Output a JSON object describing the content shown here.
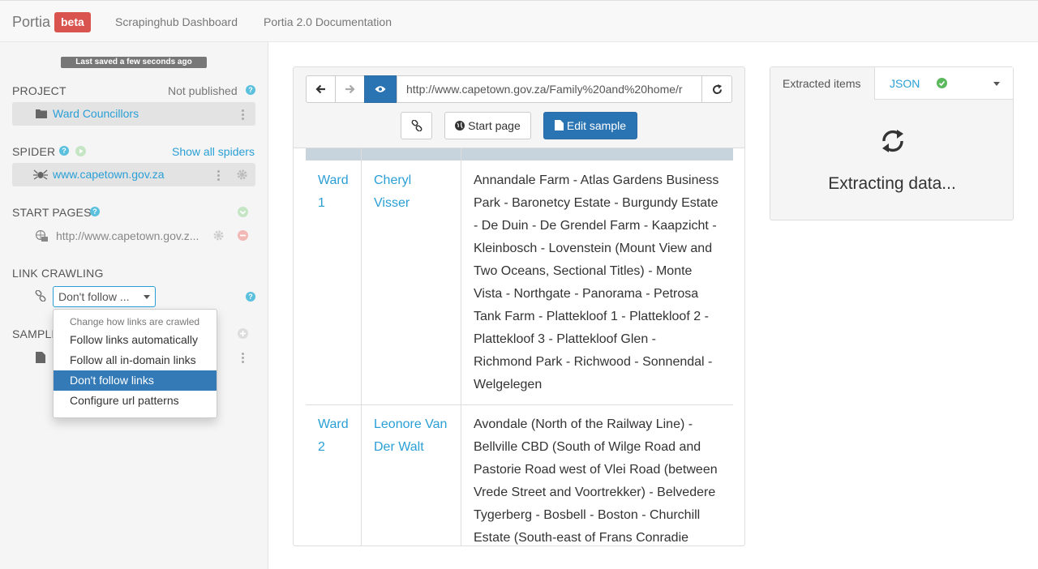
{
  "navbar": {
    "brand": "Portia",
    "badge": "beta",
    "links": [
      "Scrapinghub Dashboard",
      "Portia 2.0 Documentation"
    ]
  },
  "sidebar": {
    "saved_status": "Last saved a few seconds ago",
    "project": {
      "heading": "PROJECT",
      "status": "Not published",
      "name": "Ward Councillors"
    },
    "spider": {
      "heading": "SPIDER",
      "show_all": "Show all spiders",
      "name": "www.capetown.gov.za"
    },
    "start_pages": {
      "heading": "START PAGES",
      "url": "http://www.capetown.gov.z..."
    },
    "link_crawling": {
      "heading": "LINK CRAWLING",
      "selected": "Don't follow ...",
      "dropdown_header": "Change how links are crawled",
      "options": [
        "Follow links automatically",
        "Follow all in-domain links",
        "Don't follow links",
        "Configure url patterns"
      ],
      "active_index": 2
    },
    "samples": {
      "heading": "SAMPLE"
    }
  },
  "browser": {
    "url": "http://www.capetown.gov.za/Family%20and%20home/r",
    "start_page_label": "Start page",
    "edit_sample_label": "Edit sample",
    "rows": [
      {
        "ward": "Ward 1",
        "ward_lines": [
          "Ward",
          "1"
        ],
        "councillor_lines": [
          "Cheryl",
          "Visser"
        ],
        "area_lines": [
          "Annandale Farm - Atlas Gardens Business",
          "Park - Baronetcy Estate - Burgundy Estate",
          "- De Duin - De Grendel Farm - Kaapzicht -",
          "Kleinbosch - Lovenstein (Mount View and",
          "Two Oceans, Sectional Titles) - Monte",
          "Vista - Northgate - Panorama - Petrosa",
          "Tank Farm - Plattekloof 1 - Plattekloof 2 -",
          "Plattekloof 3 - Plattekloof Glen -",
          "Richmond Park - Richwood - Sonnendal -",
          "Welgelegen"
        ]
      },
      {
        "ward": "Ward 2",
        "ward_lines": [
          "Ward",
          "2"
        ],
        "councillor_lines": [
          "Leonore Van",
          "Der Walt"
        ],
        "area_lines": [
          "Avondale (North of the Railway Line) -",
          "Bellville CBD (South of Wilge Road and",
          "Pastorie Road west of Vlei Road (between",
          "Vrede Street and Voortrekker) - Belvedere",
          "Tygerberg - Bosbell - Boston - Churchill",
          "Estate (South-east of Frans Conradie"
        ]
      }
    ]
  },
  "panel": {
    "tab_label": "Extracted items",
    "format": "JSON",
    "status": "Extracting data..."
  },
  "colors": {
    "accent": "#2a9fd6",
    "primary": "#2a74b4",
    "danger": "#d9534f",
    "success": "#5cb85c",
    "dropdown_active": "#337ab7"
  }
}
